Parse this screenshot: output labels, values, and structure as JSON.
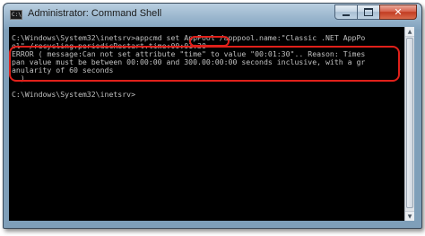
{
  "window": {
    "title": "Administrator: Command Shell",
    "app_icon_glyph": "C:\\",
    "app_icon": "command-prompt-icon",
    "controls": {
      "minimize_icon": "minimize-icon",
      "maximize_icon": "maximize-icon",
      "close_icon": "close-icon",
      "close_glyph": "✕"
    }
  },
  "console": {
    "lines": [
      "C:\\Windows\\System32\\inetsrv>appcmd set AppPool /apppool.name:\"Classic .NET AppPo",
      "ol\" /recycling.periodicRestart.time:00:01:30",
      "ERROR ( message:Can not set attribute \"time\" to value \"00:01:30\".. Reason: Times",
      "pan value must be between 00:00:00 and 300.00:00:00 seconds inclusive, with a gr",
      "anularity of 60 seconds",
      ". )",
      "",
      "C:\\Windows\\System32\\inetsrv>"
    ],
    "text_color": "#c0c0c0",
    "background": "#000000"
  },
  "annotations": {
    "highlight_color": "#e0201a"
  },
  "scrollbar": {
    "up_glyph": "▲",
    "down_glyph": "▼"
  }
}
